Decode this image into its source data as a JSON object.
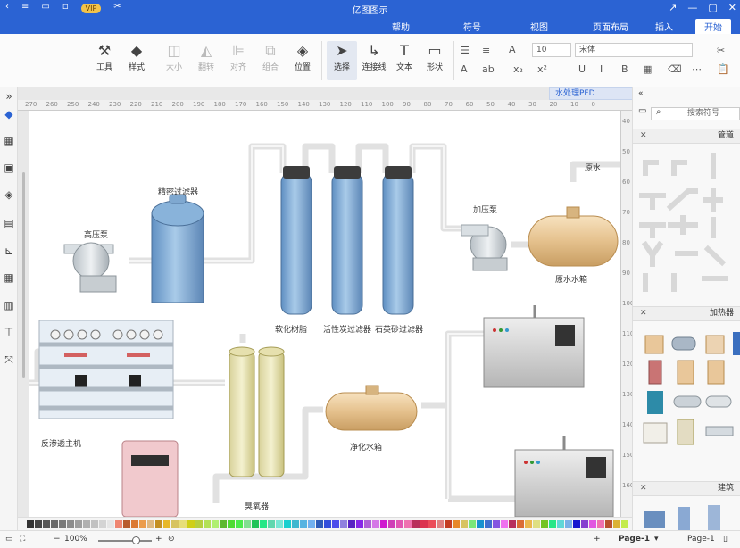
{
  "titlebar": {
    "title": "亿图图示",
    "vip": "VIP"
  },
  "tabs": [
    "开始",
    "插入",
    "页面布局",
    "视图",
    "符号",
    "帮助"
  ],
  "ribbon": {
    "tools": [
      "工具",
      "样式",
      "大小",
      "翻转",
      "对齐",
      "组合",
      "位置",
      "连接线",
      "选择",
      "文本",
      "形状"
    ],
    "font_name": "宋体",
    "font_size": "10"
  },
  "document_tab": "水处理PFD",
  "ruler_ticks": [
    "270",
    "260",
    "250",
    "240",
    "230",
    "220",
    "210",
    "200",
    "190",
    "180",
    "170",
    "160",
    "150",
    "140",
    "130",
    "120",
    "110",
    "100",
    "90",
    "80",
    "70",
    "60",
    "50",
    "40",
    "30",
    "20",
    "10",
    "0"
  ],
  "ruler_ticks_v": [
    "40",
    "50",
    "60",
    "70",
    "80",
    "90",
    "100",
    "110",
    "120",
    "130",
    "140",
    "150",
    "160"
  ],
  "diagram": {
    "labels": {
      "precision_filter": "精密过滤器",
      "high_pressure_pump": "高压泵",
      "softener": "软化树脂",
      "activated_carbon": "活性炭过滤器",
      "quartz_sand": "石英砂过滤器",
      "booster_pump": "加压泵",
      "raw_water": "原水",
      "raw_water_tank": "原水水箱",
      "ro_host": "反渗透主机",
      "ozone": "臭氧器",
      "purified_tank": "净化水箱"
    }
  },
  "right_panel": {
    "search_placeholder": "搜索符号",
    "sections": [
      "管道",
      "加热器",
      "建筑"
    ]
  },
  "status": {
    "zoom": "100%",
    "page_left": "Page-1",
    "page_right": "Page-1"
  },
  "colors": {
    "titlebar": "#2b63d3",
    "pipe": "#e1e1e1"
  }
}
